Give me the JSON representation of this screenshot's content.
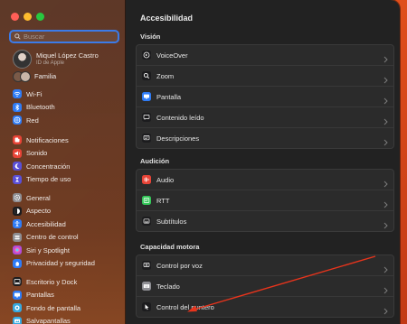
{
  "sidebar": {
    "search": {
      "placeholder": "Buscar"
    },
    "user": {
      "name": "Miquel López Castro",
      "subtitle": "ID de Apple"
    },
    "family": {
      "label": "Familia"
    },
    "groups": [
      [
        {
          "label": "Wi-Fi",
          "icon": "wifi-icon",
          "color": "#2f7cf6"
        },
        {
          "label": "Bluetooth",
          "icon": "bluetooth-icon",
          "color": "#2f7cf6"
        },
        {
          "label": "Red",
          "icon": "globe-icon",
          "color": "#2f7cf6"
        }
      ],
      [
        {
          "label": "Notificaciones",
          "icon": "notifications-icon",
          "color": "#e84437"
        },
        {
          "label": "Sonido",
          "icon": "sound-icon",
          "color": "#e84437"
        },
        {
          "label": "Concentración",
          "icon": "moon-icon",
          "color": "#5a4fd6"
        },
        {
          "label": "Tiempo de uso",
          "icon": "hourglass-icon",
          "color": "#5a4fd6"
        }
      ],
      [
        {
          "label": "General",
          "icon": "gear-icon",
          "color": "#8e8e93"
        },
        {
          "label": "Aspecto",
          "icon": "appearance-icon",
          "color": "#1c1c1e"
        },
        {
          "label": "Accesibilidad",
          "icon": "accessibility-icon",
          "color": "#2f7cf6"
        },
        {
          "label": "Centro de control",
          "icon": "control-center-icon",
          "color": "#8e8e93"
        },
        {
          "label": "Siri y Spotlight",
          "icon": "siri-icon",
          "color": "#b44cd9"
        },
        {
          "label": "Privacidad y seguridad",
          "icon": "hand-icon",
          "color": "#2f7cf6"
        }
      ],
      [
        {
          "label": "Escritorio y Dock",
          "icon": "dock-icon",
          "color": "#1c1c1e"
        },
        {
          "label": "Pantallas",
          "icon": "display-icon",
          "color": "#2f7cf6"
        },
        {
          "label": "Fondo de pantalla",
          "icon": "wallpaper-icon",
          "color": "#36a9e0"
        },
        {
          "label": "Salvapantallas",
          "icon": "screensaver-icon",
          "color": "#36a9e0"
        }
      ]
    ]
  },
  "main": {
    "title": "Accesibilidad",
    "sections": [
      {
        "title": "Visión",
        "items": [
          {
            "label": "VoiceOver",
            "icon": "voiceover-icon",
            "color": "#1c1c1e"
          },
          {
            "label": "Zoom",
            "icon": "zoom-icon",
            "color": "#1c1c1e"
          },
          {
            "label": "Pantalla",
            "icon": "display-icon",
            "color": "#2f7cf6"
          },
          {
            "label": "Contenido leído",
            "icon": "spoken-content-icon",
            "color": "#1c1c1e"
          },
          {
            "label": "Descripciones",
            "icon": "descriptions-icon",
            "color": "#1c1c1e"
          }
        ]
      },
      {
        "title": "Audición",
        "items": [
          {
            "label": "Audio",
            "icon": "audio-icon",
            "color": "#e84437"
          },
          {
            "label": "RTT",
            "icon": "rtt-icon",
            "color": "#34c759"
          },
          {
            "label": "Subtítulos",
            "icon": "subtitles-icon",
            "color": "#1c1c1e"
          }
        ]
      },
      {
        "title": "Capacidad motora",
        "items": [
          {
            "label": "Control por voz",
            "icon": "voice-control-icon",
            "color": "#1c1c1e"
          },
          {
            "label": "Teclado",
            "icon": "keyboard-icon",
            "color": "#8e8e93"
          },
          {
            "label": "Control del puntero",
            "icon": "pointer-icon",
            "color": "#1c1c1e"
          }
        ]
      }
    ]
  }
}
